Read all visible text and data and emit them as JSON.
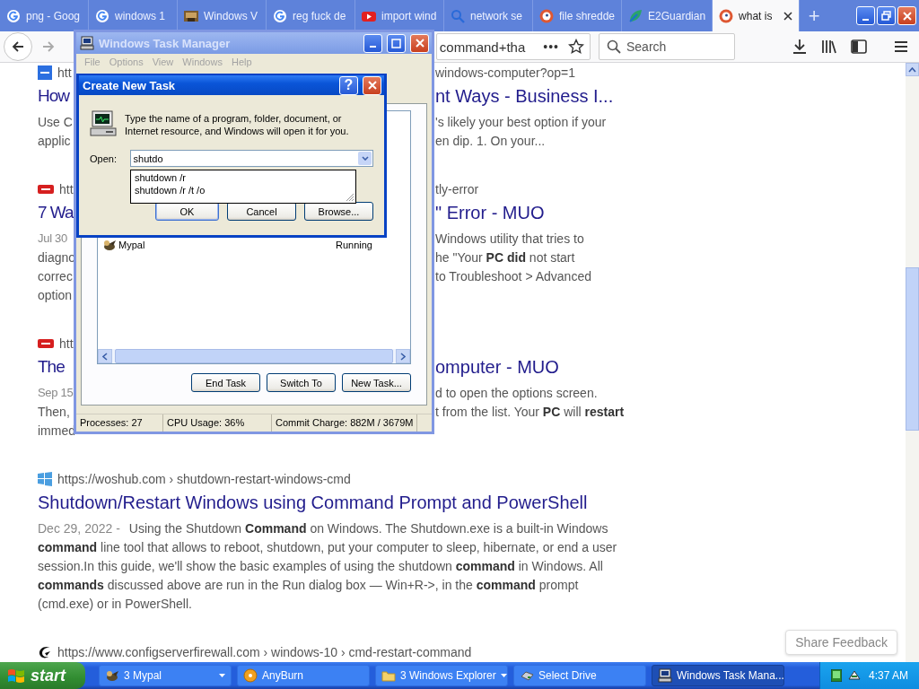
{
  "browser": {
    "tabs": [
      {
        "title": "png - Goog",
        "kind": "g",
        "selected": false
      },
      {
        "title": "windows 1",
        "kind": "g",
        "selected": false
      },
      {
        "title": "Windows V",
        "kind": "image",
        "selected": false
      },
      {
        "title": "reg fuck de",
        "kind": "g",
        "selected": false
      },
      {
        "title": "import wind",
        "kind": "play",
        "selected": false
      },
      {
        "title": "network se",
        "kind": "magnifier",
        "selected": false
      },
      {
        "title": "file shredde",
        "kind": "duck",
        "selected": false
      },
      {
        "title": "E2Guardian",
        "kind": "leaf",
        "selected": false
      },
      {
        "title": "what is",
        "kind": "duck",
        "selected": true
      }
    ],
    "new_tab": "+",
    "address_text": "command+tha",
    "page_actions": "•••",
    "search_placeholder": "Search",
    "results": [
      {
        "kind": "square",
        "lines": [
          {
            "kind": "url",
            "left": "htt",
            "right": "windows-computer?op=1"
          },
          {
            "kind": "title",
            "left": "How",
            "right": "nt Ways - Business I..."
          },
          {
            "kind": "snippet",
            "left": "Use C",
            "right": "'s likely your best option if your"
          },
          {
            "kind": "snippet",
            "left": "applic",
            "right": "en dip. 1. On your..."
          }
        ]
      },
      {
        "kind": "badge",
        "lines": [
          {
            "kind": "url",
            "left": "htt",
            "right": "tly-error"
          },
          {
            "kind": "title",
            "left": "7 Wa",
            "right": "\" Error - MUO"
          },
          {
            "kind": "snippet",
            "date": "Jul 30",
            "right": "Windows utility that tries to"
          },
          {
            "kind": "snippet",
            "left": "diagno",
            "right": "he \"Your **PC did** not start"
          },
          {
            "kind": "snippet",
            "left": "correc",
            "right": "to Troubleshoot > Advanced"
          },
          {
            "kind": "snippet",
            "left": "option"
          }
        ]
      },
      {
        "kind": "badge",
        "lines": [
          {
            "kind": "url",
            "left": "htt"
          },
          {
            "kind": "title",
            "left": "The",
            "right": "omputer - MUO"
          },
          {
            "kind": "snippet",
            "date": "Sep 15",
            "right": "d to open the options screen."
          },
          {
            "kind": "snippet",
            "left": "Then,",
            "right": "t from the list. Your **PC** will **restart**"
          },
          {
            "kind": "snippet",
            "left": "immed"
          }
        ]
      },
      {
        "kind": "windows",
        "lines": [
          {
            "kind": "url",
            "left": "https://woshub.com › shutdown-restart-windows-cmd"
          },
          {
            "kind": "title",
            "left": "Shutdown/Restart Windows using Command Prompt and PowerShell"
          },
          {
            "kind": "snippet",
            "date": "Dec 29, 2022 -",
            "left": "Using the Shutdown **Command** on Windows. The Shutdown.exe is a built-in Windows"
          },
          {
            "kind": "snippet",
            "left": "**command** line tool that allows to reboot, shutdown, put your computer to sleep, hibernate, or end a user"
          },
          {
            "kind": "snippet",
            "left": "session.In this guide, we'll show the basic examples of using the shutdown **command** in Windows. All"
          },
          {
            "kind": "snippet",
            "left": "**commands** discussed above are run in the Run dialog box — Win+R->, in the **command** prompt"
          },
          {
            "kind": "snippet",
            "left": "(cmd.exe) or in PowerShell."
          }
        ]
      },
      {
        "kind": "swirl",
        "lines": [
          {
            "kind": "url",
            "left": "https://www.configserverfirewall.com › windows-10 › cmd-restart-command"
          }
        ]
      }
    ],
    "feedback_button": "Share Feedback"
  },
  "task_manager": {
    "title": "Windows Task Manager",
    "active": false,
    "menu": [
      "File",
      "Options",
      "View",
      "Windows",
      "Help"
    ],
    "rows": [
      {
        "name": "Mypal",
        "status": "Running"
      }
    ],
    "buttons": [
      "End Task",
      "Switch To",
      "New Task..."
    ],
    "status_bar": [
      "Processes: 27",
      "CPU Usage: 36%",
      "Commit Charge: 882M / 3679M"
    ]
  },
  "dialog": {
    "title": "Create New Task",
    "active": true,
    "help": "?",
    "message": "Type the name of a program, folder, document, or Internet resource, and Windows will open it for you.",
    "open_label": "Open:",
    "open_value": "shutdo",
    "suggestions": [
      "shutdown /r",
      "shutdown /r /t /o"
    ],
    "buttons": [
      {
        "label": "OK",
        "default": true
      },
      {
        "label": "Cancel",
        "default": false
      },
      {
        "label": "Browse...",
        "default": false
      }
    ]
  },
  "taskbar": {
    "start": "start",
    "items": [
      {
        "label": "3 Mypal",
        "kind": "mypal",
        "grouped": true,
        "selected": false
      },
      {
        "label": "AnyBurn",
        "kind": "disc",
        "grouped": false,
        "selected": false
      },
      {
        "label": "3 Windows Explorer",
        "kind": "folder",
        "grouped": true,
        "selected": false
      },
      {
        "label": "Select Drive",
        "kind": "drive",
        "grouped": false,
        "selected": false
      },
      {
        "label": "Windows Task Mana...",
        "kind": "computer",
        "grouped": false,
        "selected": true
      }
    ],
    "clock": "4:37 AM"
  }
}
